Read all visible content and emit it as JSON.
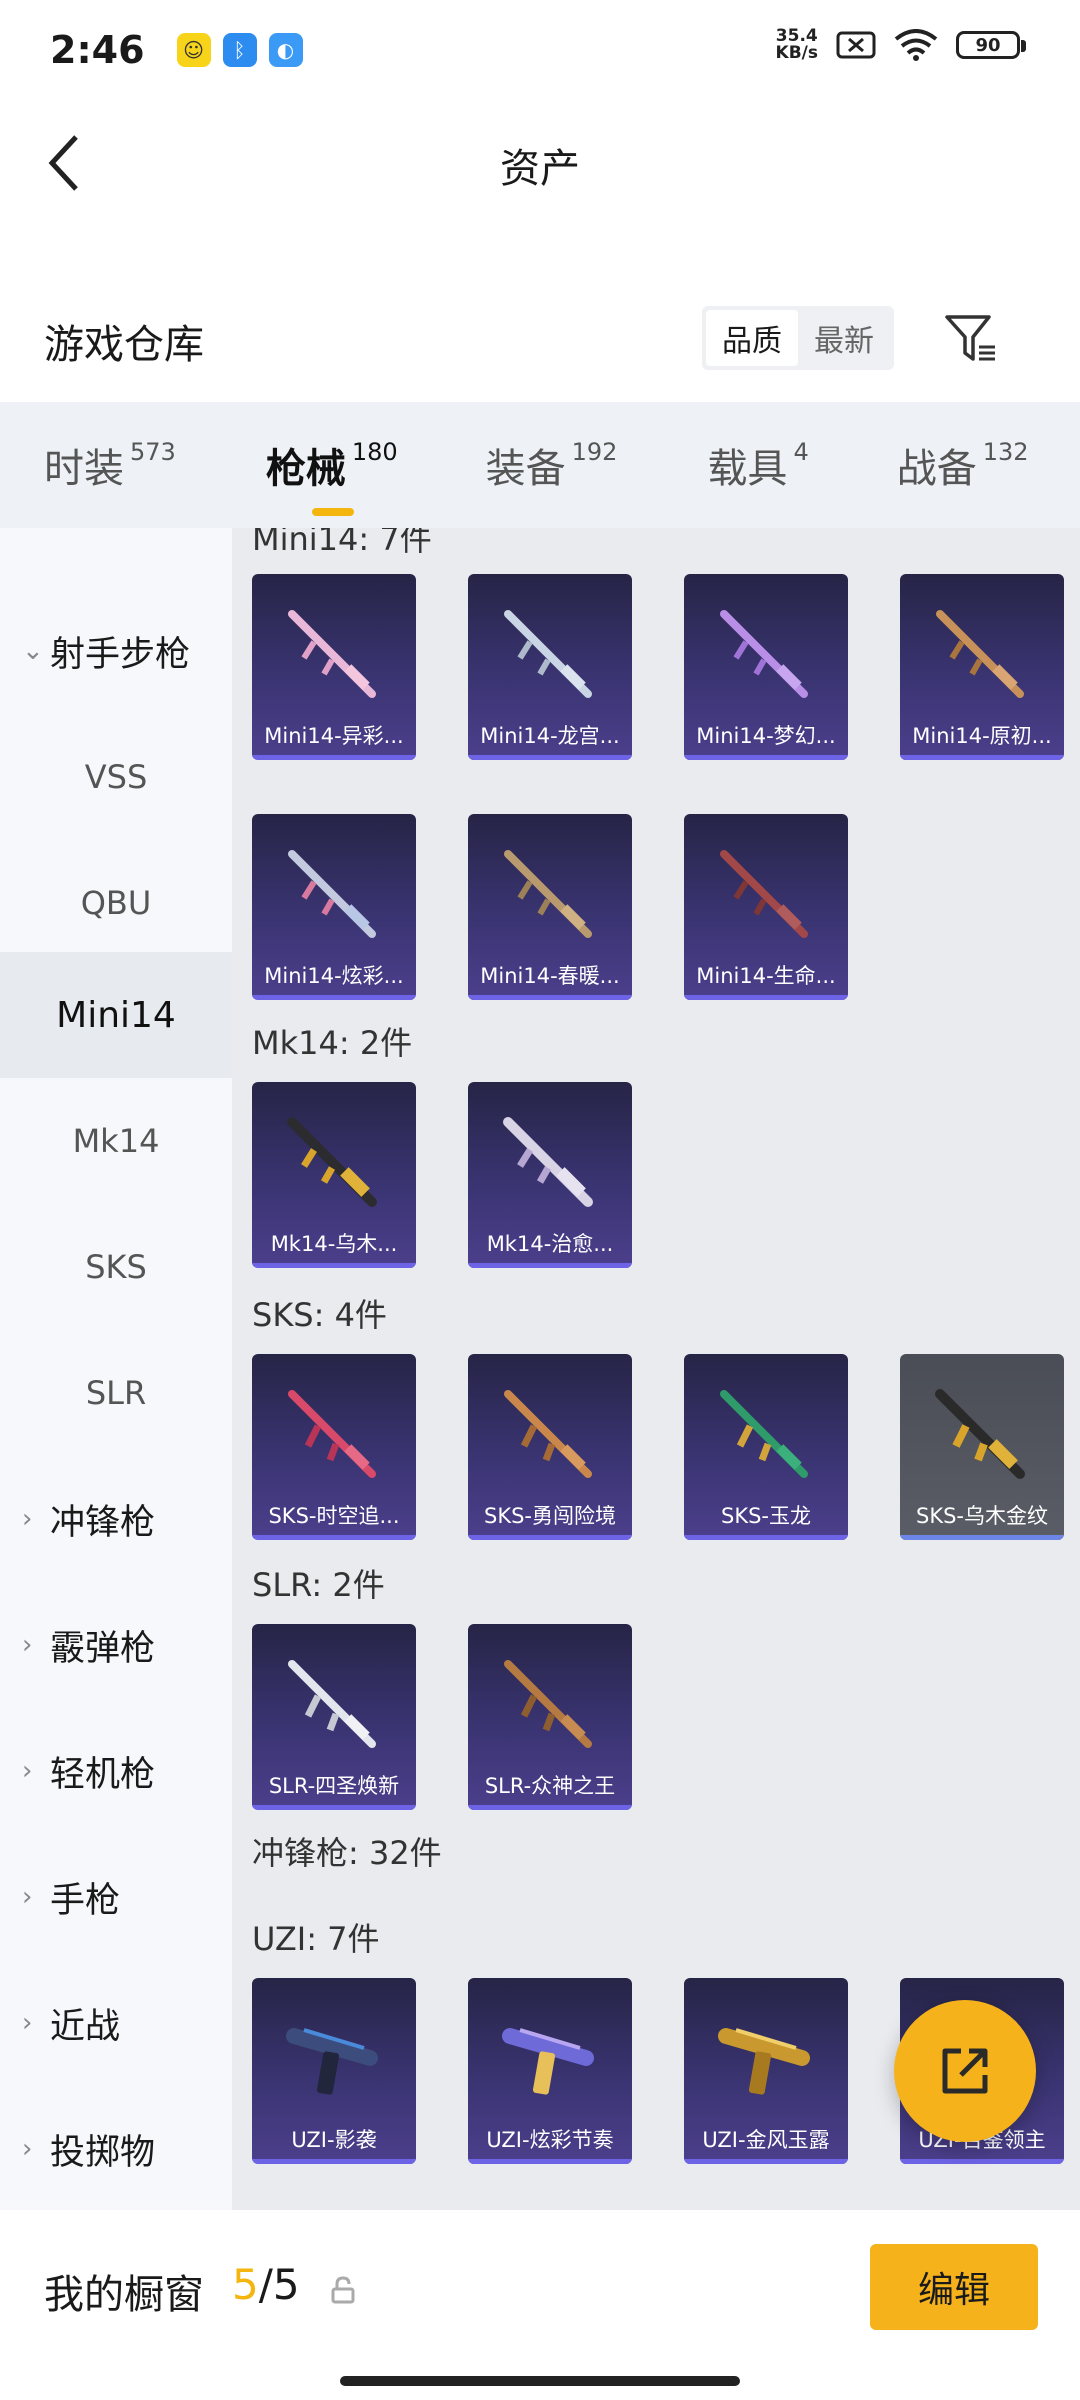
{
  "status_bar": {
    "time": "2:46",
    "net_speed_value": "35.4",
    "net_speed_unit": "KB/s",
    "battery": "90"
  },
  "header": {
    "title": "资产"
  },
  "warehouse": {
    "title": "游戏仓库",
    "sort_options": [
      "品质",
      "最新"
    ],
    "active_sort": "品质"
  },
  "category_tabs": [
    {
      "label": "时装",
      "count": "573"
    },
    {
      "label": "枪械",
      "count": "180",
      "active": true
    },
    {
      "label": "装备",
      "count": "192"
    },
    {
      "label": "载具",
      "count": "4"
    },
    {
      "label": "战备",
      "count": "132"
    }
  ],
  "sidebar": {
    "items": [
      {
        "label": "射手步枪",
        "type": "group",
        "expanded": true
      },
      {
        "label": "VSS",
        "type": "sub"
      },
      {
        "label": "QBU",
        "type": "sub"
      },
      {
        "label": "Mini14",
        "type": "sub",
        "active": true
      },
      {
        "label": "Mk14",
        "type": "sub"
      },
      {
        "label": "SKS",
        "type": "sub"
      },
      {
        "label": "SLR",
        "type": "sub"
      },
      {
        "label": "冲锋枪",
        "type": "group"
      },
      {
        "label": "霰弹枪",
        "type": "group"
      },
      {
        "label": "轻机枪",
        "type": "group"
      },
      {
        "label": "手枪",
        "type": "group"
      },
      {
        "label": "近战",
        "type": "group"
      },
      {
        "label": "投掷物",
        "type": "group"
      }
    ]
  },
  "sections": {
    "mini14_label": "Mini14: 7件",
    "mini14": [
      "Mini14-异彩...",
      "Mini14-龙宫...",
      "Mini14-梦幻...",
      "Mini14-原初...",
      "Mini14-炫彩...",
      "Mini14-春暖...",
      "Mini14-生命..."
    ],
    "mk14_label": "Mk14: 2件",
    "mk14": [
      "Mk14-乌木...",
      "Mk14-治愈..."
    ],
    "sks_label": "SKS: 4件",
    "sks": [
      "SKS-时空追...",
      "SKS-勇闯险境",
      "SKS-玉龙",
      "SKS-乌木金纹"
    ],
    "slr_label": "SLR: 2件",
    "slr": [
      "SLR-四圣焕新",
      "SLR-众神之王"
    ],
    "smg_label": "冲锋枪: 32件",
    "uzi_label": "UZI: 7件",
    "uzi": [
      "UZI-影袭",
      "UZI-炫彩节奏",
      "UZI-金风玉露",
      "UZI-百鉴领主"
    ]
  },
  "bottom_bar": {
    "window_label": "我的橱窗",
    "count_used": "5",
    "count_sep_total": "/5",
    "edit_label": "编辑"
  },
  "colors": {
    "accent": "#f6b21a",
    "card_purple": "#3a3472",
    "card_gray": "#5a5d66"
  }
}
